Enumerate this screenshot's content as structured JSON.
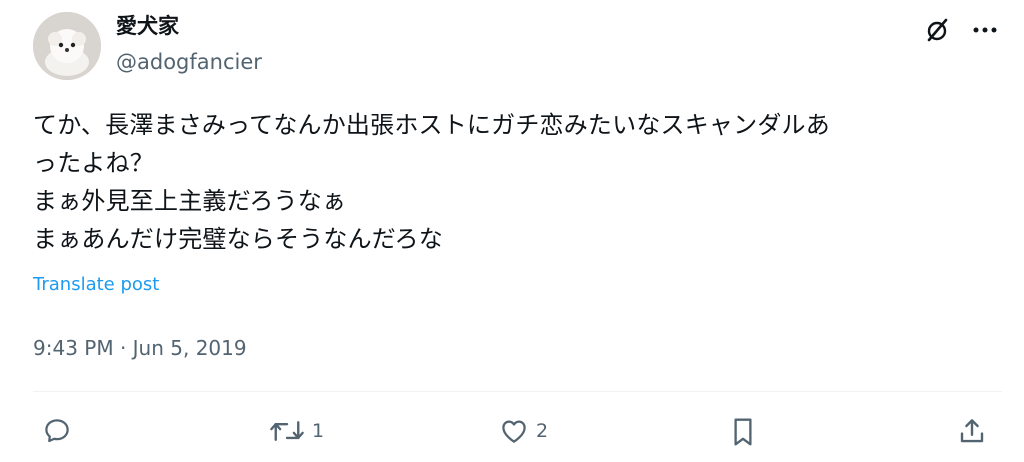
{
  "tweet": {
    "author": {
      "display_name": "愛犬家",
      "handle": "@adogfancier",
      "avatar_alt": "white puppy avatar"
    },
    "text": "てか、長澤まさみってなんか出張ホストにガチ恋みたいなスキャンダルあ\nったよね？\nまぁ外見至上主義だろうなぁ\nまぁあんだけ完璧ならそうなんだろな",
    "translate_label": "Translate post",
    "timestamp": "9:43 PM · Jun 5, 2019",
    "actions": {
      "reply_count": "",
      "retweet_count": "1",
      "like_count": "2"
    }
  },
  "icons": {
    "top": [
      "grok-slash-icon",
      "more-icon"
    ],
    "actions": [
      "reply-icon",
      "retweet-icon",
      "like-icon",
      "bookmark-icon",
      "share-icon"
    ]
  },
  "colors": {
    "text": "#0f1419",
    "secondary": "#536471",
    "link": "#1d9bf0"
  }
}
